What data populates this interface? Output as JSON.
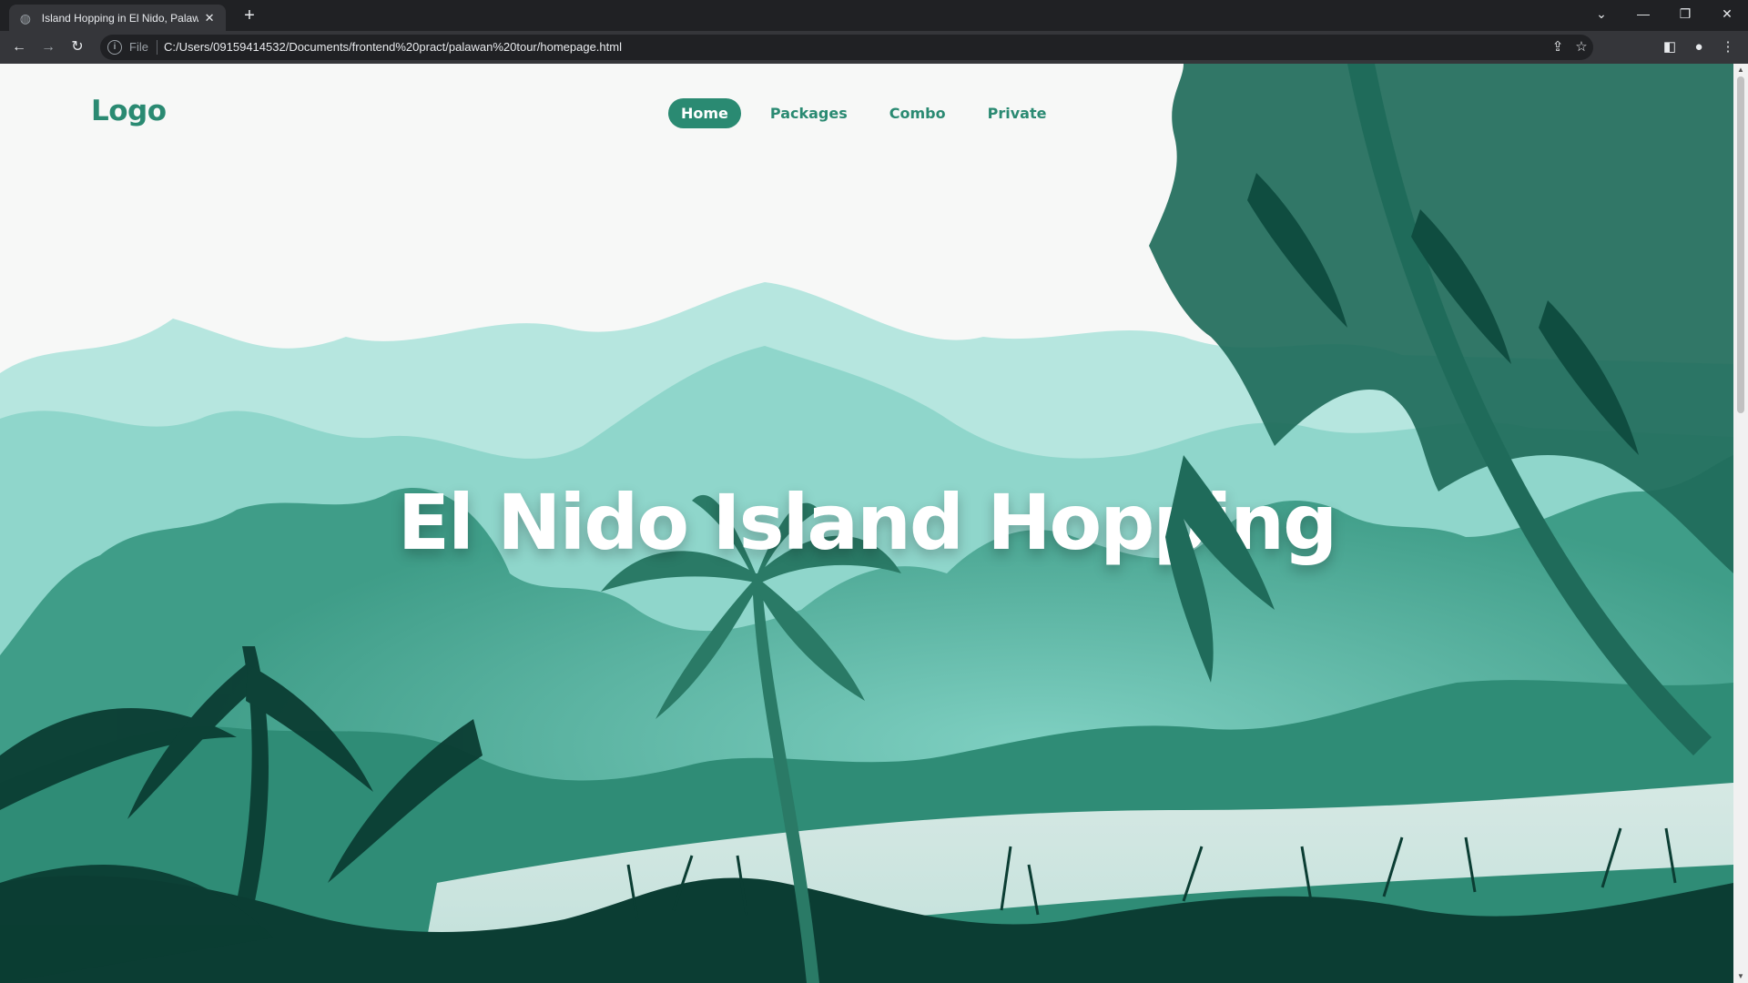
{
  "browser": {
    "tab_title": "Island Hopping in El Nido, Palawan",
    "address_scheme": "File",
    "url": "C:/Users/09159414532/Documents/frontend%20pract/palawan%20tour/homepage.html"
  },
  "site": {
    "logo": "Logo",
    "nav": [
      {
        "label": "Home",
        "active": true
      },
      {
        "label": "Packages",
        "active": false
      },
      {
        "label": "Combo",
        "active": false
      },
      {
        "label": "Private",
        "active": false
      }
    ],
    "hero_title": "El Nido Island Hopping"
  },
  "colors": {
    "brand": "#2a8a72",
    "sky": "#f7f8f7",
    "mountain_far": "#b6e6df",
    "mountain_mid": "#8fd6cb",
    "jungle": "#3f9d88",
    "foreground": "#0b3d33"
  }
}
